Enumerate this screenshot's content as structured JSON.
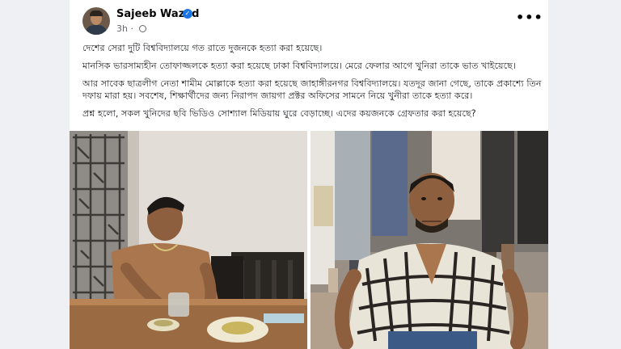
{
  "post": {
    "author": "Sajeeb Wazed",
    "time": "3h",
    "more_label": "•••",
    "paragraphs": [
      "দেশের সেরা দুটি বিশ্ববিদ্যালয়ে গত রাতে দুজনকে হত্যা করা হয়েছে।",
      "মানসিক ভারসাম্যহীন তোফাজ্জলকে হত্যা করা হয়েছে ঢাকা বিশ্ববিদ্যালয়ে। মেরে ফেলার আগে খুনিরা তাকে ভাত খাইয়েছে।",
      "আর সাবেক ছাত্রলীগ নেতা শামীম মোল্লাকে হত্যা করা হয়েছে জাহাঙ্গীরনগর বিশ্ববিদ্যালয়ে। যতদূর জানা গেছে, তাকে প্রকাশ্যে তিন দফায় মারা হয়। সবশেষ, শিক্ষার্থীদের জন্য নিরাপদ জায়গা প্রক্টর অফিসের সামনে নিয়ে খুনীরা তাকে হত্যা করে।",
      "প্রশ্ন হলো, সকল খুনিদের ছবি ভিডিও সোশ্যাল মিডিয়ায় ঘুরে বেড়াচ্ছে। এদের কয়জনকে গ্রেফতার করা হয়েছে?"
    ]
  },
  "colors": {
    "background": "#eef0f3",
    "card": "#ffffff",
    "verified": "#1b74e4",
    "text": "#1c1e21",
    "meta": "#65676b"
  },
  "icons": [
    "verified-badge-icon",
    "globe-icon",
    "more-options-icon"
  ]
}
